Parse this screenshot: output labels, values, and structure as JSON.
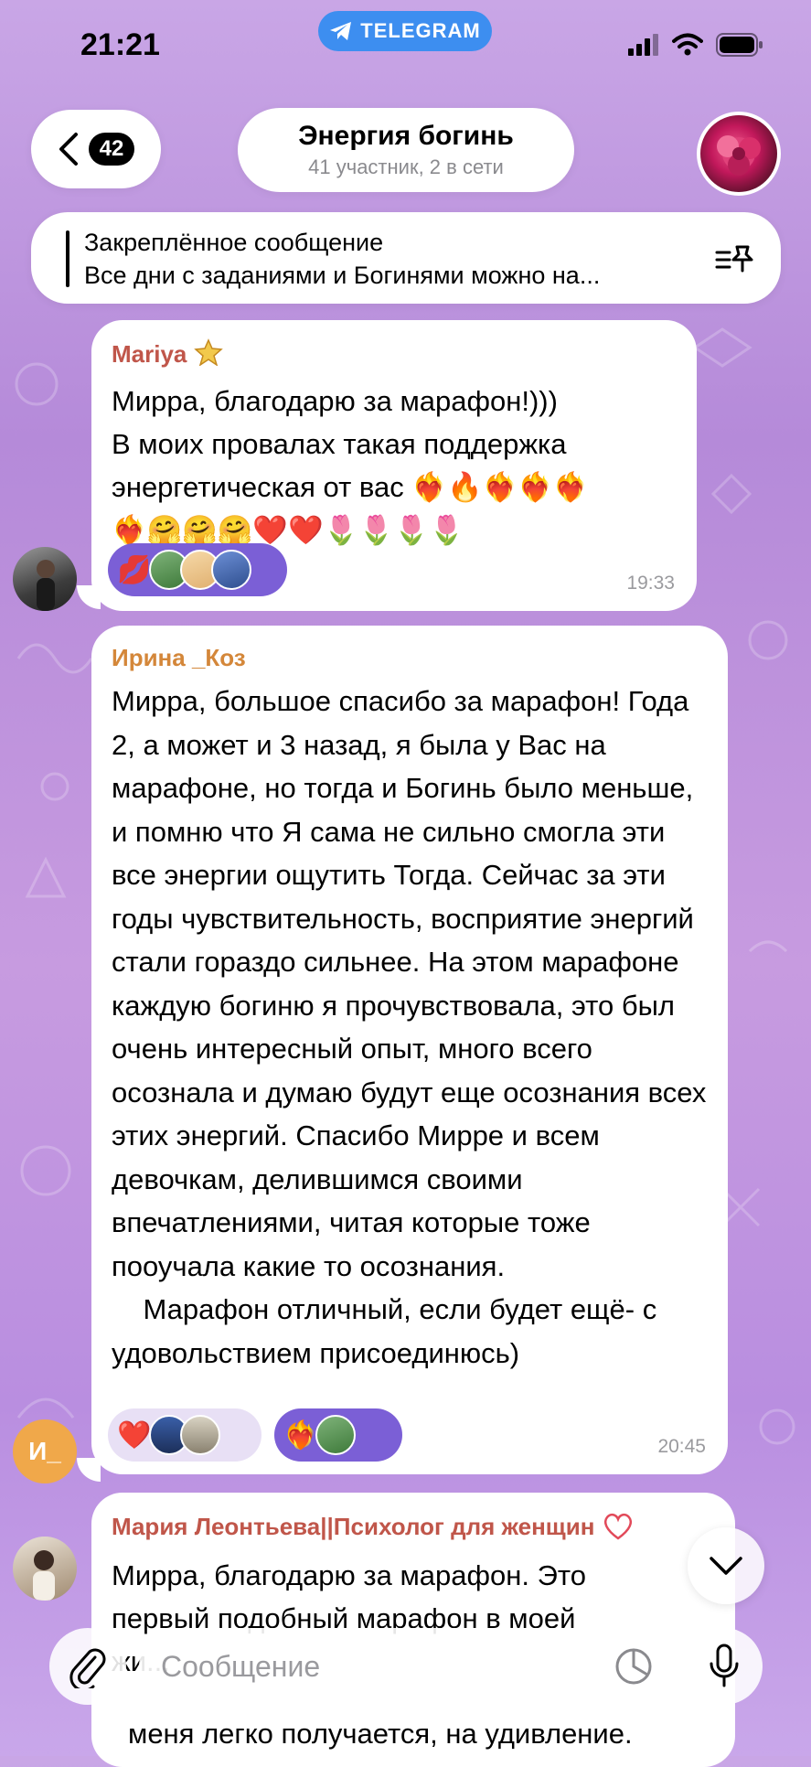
{
  "status_bar": {
    "time": "21:21",
    "app_pill": "TELEGRAM"
  },
  "header": {
    "back_count": "42",
    "title": "Энергия богинь",
    "subtitle": "41 участник, 2 в сети"
  },
  "pinned": {
    "title": "Закреплённое сообщение",
    "text": "Все дни с заданиями и Богинями можно на..."
  },
  "messages": [
    {
      "sender": "Mariya",
      "sender_color": "#c0564a",
      "text": "Мирра, благодарю за марафон!)))\nВ моих провалах такая поддержка энергетическая от вас ❤️‍🔥🔥❤️‍🔥❤️‍🔥❤️‍🔥\n❤️‍🔥🤗🤗🤗❤️❤️🌷🌷🌷🌷",
      "time": "19:33",
      "reactions": [
        "💋"
      ]
    },
    {
      "sender": "Ирина _Коз",
      "sender_color": "#d4873a",
      "avatar_initials": "И_",
      "text": "Мирра, большое спасибо за марафон! Года 2, а может и 3 назад, я была у Вас на марафоне, но тогда и Богинь было меньше, и помню что Я сама не сильно смогла эти все энергии ощутить Тогда. Сейчас за эти годы чувствительность, восприятие энергий стали гораздо сильнее. На этом марафоне каждую богиню я прочувствовала, это был очень интересный опыт, много всего осознала и думаю будут еще осознания всех этих энергий. Спасибо Мирре и всем девочкам, делившимся своими впечатлениями, читая которые тоже пооучала какие то осознания.\n    Марафон отличный, если будет ещё- с удовольствием присоединюсь)",
      "time": "20:45",
      "reactions": [
        "❤️",
        "❤️‍🔥"
      ]
    },
    {
      "sender": "Мария Леонтьева||Психолог для женщин",
      "sender_color": "#c0564a",
      "text": "Мирра, благодарю за марафон. Это первый подобный марафон в моей жи...",
      "text_bottom": "меня легко получается, на удивление."
    }
  ],
  "input": {
    "placeholder": "Сообщение"
  },
  "colors": {
    "accent": "#3d8ef0",
    "reaction_bg": "#7b5fd6"
  }
}
